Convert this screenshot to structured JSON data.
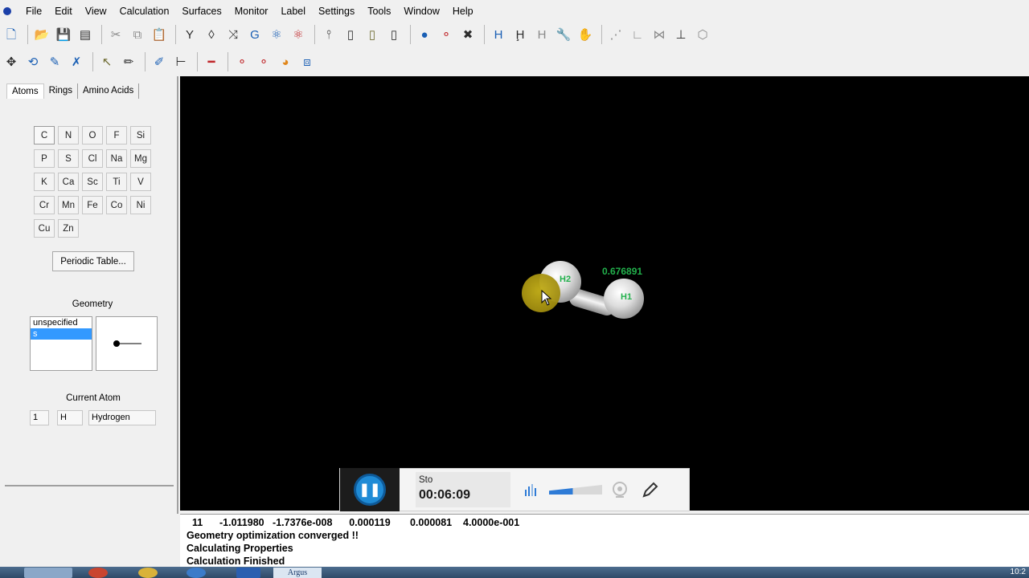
{
  "menu": [
    "File",
    "Edit",
    "View",
    "Calculation",
    "Surfaces",
    "Monitor",
    "Label",
    "Settings",
    "Tools",
    "Window",
    "Help"
  ],
  "toolbar1": [
    {
      "name": "new-icon",
      "glyph": "🗋",
      "color": "c-blue"
    },
    {
      "sep": true
    },
    {
      "name": "open-icon",
      "glyph": "📂",
      "color": "c-dark"
    },
    {
      "name": "save-icon",
      "glyph": "💾",
      "color": "c-dark"
    },
    {
      "name": "print-icon",
      "glyph": "▤",
      "color": "c-dark"
    },
    {
      "sep": true
    },
    {
      "name": "cut-icon",
      "glyph": "✂",
      "color": "c-grey"
    },
    {
      "name": "copy-icon",
      "glyph": "⧉",
      "color": "c-grey"
    },
    {
      "name": "paste-icon",
      "glyph": "📋",
      "color": "c-dark"
    },
    {
      "sep": true
    },
    {
      "name": "add-hydrogens-icon",
      "glyph": "Y",
      "color": "c-dark"
    },
    {
      "name": "clean-icon",
      "glyph": "◊",
      "color": "c-dark"
    },
    {
      "name": "symmetry-icon",
      "glyph": "⤨",
      "color": "c-dark"
    },
    {
      "name": "rotate-c-icon",
      "glyph": "G",
      "color": "c-blue"
    },
    {
      "name": "orbital-icon",
      "glyph": "⚛",
      "color": "c-blue"
    },
    {
      "name": "density-icon",
      "glyph": "⚛",
      "color": "c-red"
    },
    {
      "sep": true
    },
    {
      "name": "bond-single-icon",
      "glyph": "⫯",
      "color": "c-dark"
    },
    {
      "name": "bond-double-icon",
      "glyph": "▯",
      "color": "c-dark"
    },
    {
      "name": "bond-triple-icon",
      "glyph": "▯",
      "color": "c-olive"
    },
    {
      "name": "bond-aromatic-icon",
      "glyph": "▯",
      "color": "c-dark"
    },
    {
      "sep": true
    },
    {
      "name": "atom-ball-icon",
      "glyph": "●",
      "color": "c-blue"
    },
    {
      "name": "atom-pair-icon",
      "glyph": "⚬",
      "color": "c-red"
    },
    {
      "name": "delete-atoms-icon",
      "glyph": "✖",
      "color": "c-dark"
    },
    {
      "sep": true
    },
    {
      "name": "hydrogen-h-icon",
      "glyph": "H",
      "color": "c-blue"
    },
    {
      "name": "hydrogen-edit-icon",
      "glyph": "Ḩ",
      "color": "c-dark"
    },
    {
      "name": "hydrogen-grey-icon",
      "glyph": "H",
      "color": "c-grey"
    },
    {
      "name": "wrench-icon",
      "glyph": "🔧",
      "color": "c-dark"
    },
    {
      "name": "hand-icon",
      "glyph": "✋",
      "color": "c-grey"
    },
    {
      "sep": true
    },
    {
      "name": "measure-distance-icon",
      "glyph": "⋰",
      "color": "c-grey"
    },
    {
      "name": "measure-angle-icon",
      "glyph": "∟",
      "color": "c-grey"
    },
    {
      "name": "measure-dihedral-icon",
      "glyph": "⋈",
      "color": "c-grey"
    },
    {
      "name": "axis-icon",
      "glyph": "⊥",
      "color": "c-dark"
    },
    {
      "name": "ring-measure-icon",
      "glyph": "⬡",
      "color": "c-grey"
    }
  ],
  "toolbar2": [
    {
      "name": "move-icon",
      "glyph": "✥",
      "color": "c-dark"
    },
    {
      "name": "rotate-icon",
      "glyph": "⟲",
      "color": "c-blue"
    },
    {
      "name": "edit-bond-icon",
      "glyph": "✎",
      "color": "c-blue"
    },
    {
      "name": "delete-bond-icon",
      "glyph": "✗",
      "color": "c-blue"
    },
    {
      "sep": true
    },
    {
      "name": "select-arrow-icon",
      "glyph": "↖",
      "color": "c-olive"
    },
    {
      "name": "pencil-icon",
      "glyph": "✏",
      "color": "c-dark"
    },
    {
      "sep": true
    },
    {
      "name": "draw-edit-icon",
      "glyph": "✐",
      "color": "c-blue"
    },
    {
      "name": "hierarchy-icon",
      "glyph": "⊢",
      "color": "c-dark"
    },
    {
      "sep": true
    },
    {
      "name": "bond-line-icon",
      "glyph": "━",
      "color": "c-red"
    },
    {
      "sep": true
    },
    {
      "name": "atom-red-icon",
      "glyph": "⚬",
      "color": "c-red"
    },
    {
      "name": "atom-pair-blue-icon",
      "glyph": "⚬",
      "color": "c-red"
    },
    {
      "name": "color-sphere-icon",
      "glyph": "◕",
      "color": "c-orange"
    },
    {
      "name": "box-view-icon",
      "glyph": "⧈",
      "color": "c-blue"
    }
  ],
  "tabs": [
    "Atoms",
    "Rings",
    "Amino Acids"
  ],
  "elements": [
    "C",
    "N",
    "O",
    "F",
    "Si",
    "P",
    "S",
    "Cl",
    "Na",
    "Mg",
    "K",
    "Ca",
    "Sc",
    "Ti",
    "V",
    "Cr",
    "Mn",
    "Fe",
    "Co",
    "Ni",
    "Cu",
    "Zn"
  ],
  "periodic_table_button": "Periodic Table...",
  "geometry": {
    "label": "Geometry",
    "options": [
      "unspecified",
      "s"
    ],
    "selected": "s"
  },
  "current_atom": {
    "label": "Current Atom",
    "number": "1",
    "symbol": "H",
    "name": "Hydrogen"
  },
  "molecule": {
    "atom1_label": "H2",
    "atom2_label": "H1",
    "distance": "0.676891"
  },
  "recorder": {
    "status": "Sto",
    "time": "00:06:09"
  },
  "output_lines": [
    "  11      -1.011980   -1.7376e-008      0.000119       0.000081    4.0000e-001",
    "Geometry optimization converged !!",
    "Calculating Properties",
    "Calculation Finished"
  ],
  "taskbar": {
    "active_label": "Argus",
    "clock": "10:2"
  }
}
